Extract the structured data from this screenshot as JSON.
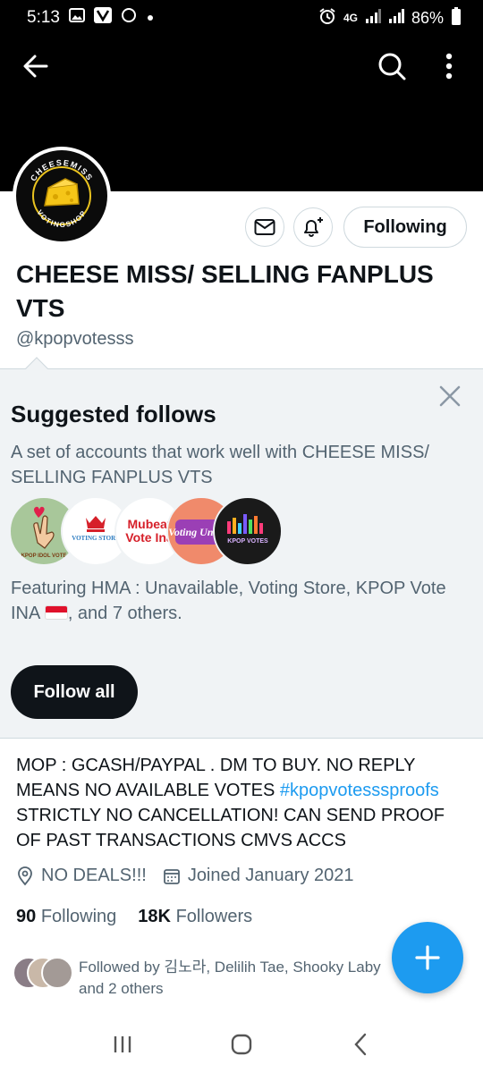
{
  "status_bar": {
    "time": "5:13",
    "network": "4G",
    "battery": "86%"
  },
  "profile": {
    "display_name": "CHEESE MISS/ SELLING FANPLUS VTS",
    "handle": "@kpopvotesss",
    "avatar_top_text": "CHEESEMISS",
    "avatar_bottom_text": "VOTINGSHOP",
    "following_button": "Following",
    "bio_text": "MOP : GCASH/PAYPAL . DM TO BUY. NO REPLY MEANS NO AVAILABLE VOTES ",
    "bio_hashtag": "#kpopvotesssproofs",
    "bio_text_after": " STRICTLY NO CANCELLATION! CAN SEND PROOF OF PAST TRANSACTIONS CMVS ACCS",
    "location": "NO DEALS!!!",
    "joined": "Joined January 2021",
    "following_count": "90",
    "following_label": "Following",
    "followers_count": "18K",
    "followers_label": "Followers",
    "followed_by": "Followed by 김노라, Delilih Tae, Shooky Laby and 2 others"
  },
  "suggested": {
    "title": "Suggested follows",
    "description": "A set of accounts that work well with CHEESE MISS/ SELLING FANPLUS VTS",
    "circle_labels": [
      "KPOP IDOL VOTE",
      "VOTING STORE",
      "Mubeat Vote Ina",
      "Voting Unnie",
      "KPOP VOTES"
    ],
    "featuring": "Featuring HMA : Unavailable, Voting Store, KPOP Vote INA",
    "featuring_suffix": ", and 7 others.",
    "follow_all": "Follow all"
  },
  "colors": {
    "accent": "#1d9bf0",
    "text": "#0f1419",
    "secondary": "#536471"
  },
  "icons": [
    "back-arrow-icon",
    "search-icon",
    "more-vertical-icon",
    "envelope-icon",
    "bell-plus-icon",
    "close-icon",
    "location-pin-icon",
    "calendar-icon",
    "plus-icon"
  ]
}
